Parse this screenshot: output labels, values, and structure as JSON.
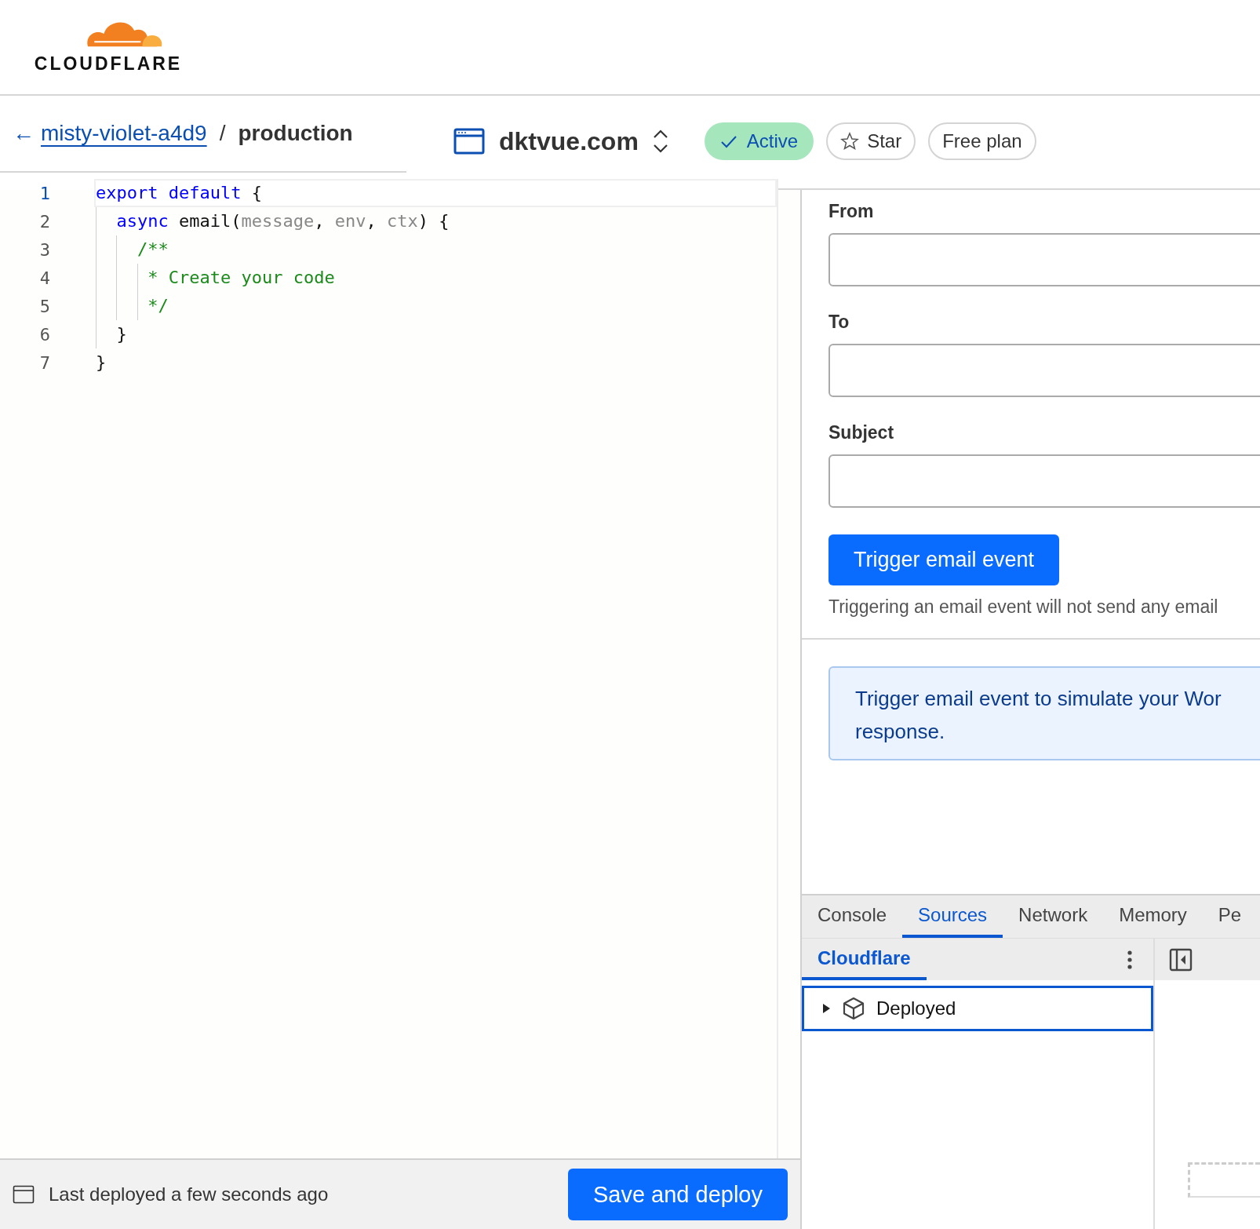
{
  "header": {
    "logo_text": "CLOUDFLARE"
  },
  "breadcrumb": {
    "back_icon": "←",
    "link": "misty-violet-a4d9",
    "separator": "/",
    "current": "production"
  },
  "domain": {
    "title": "dktvue.com",
    "status": {
      "label": "Active",
      "active": true
    },
    "star": {
      "label": "Star",
      "starred": false
    },
    "plan": "Free plan"
  },
  "editor": {
    "lines": [
      {
        "number": "1",
        "selected": true,
        "tokens": [
          {
            "kind": "keyword",
            "text": "export default"
          },
          {
            "kind": "plain",
            "text": " {"
          }
        ]
      },
      {
        "number": "2",
        "selected": false,
        "tokens": [
          {
            "kind": "keyword",
            "text": "  async"
          },
          {
            "kind": "plain",
            "text": " email("
          },
          {
            "kind": "param",
            "text": "message"
          },
          {
            "kind": "plain",
            "text": ", "
          },
          {
            "kind": "param",
            "text": "env"
          },
          {
            "kind": "plain",
            "text": ", "
          },
          {
            "kind": "param",
            "text": "ctx"
          },
          {
            "kind": "plain",
            "text": ") {"
          }
        ]
      },
      {
        "number": "3",
        "selected": false,
        "tokens": [
          {
            "kind": "comment",
            "text": "    /**"
          }
        ]
      },
      {
        "number": "4",
        "selected": false,
        "tokens": [
          {
            "kind": "comment",
            "text": "     * Create your code"
          }
        ]
      },
      {
        "number": "5",
        "selected": false,
        "tokens": [
          {
            "kind": "comment",
            "text": "     */"
          }
        ]
      },
      {
        "number": "6",
        "selected": false,
        "tokens": [
          {
            "kind": "plain",
            "text": "  }"
          }
        ]
      },
      {
        "number": "7",
        "selected": false,
        "tokens": [
          {
            "kind": "plain",
            "text": "}"
          }
        ]
      }
    ]
  },
  "footer": {
    "status": "Last deployed a few seconds ago",
    "button": "Save and deploy"
  },
  "form": {
    "fields": [
      {
        "label": "From"
      },
      {
        "label": "To"
      },
      {
        "label": "Subject"
      }
    ],
    "button": "Trigger email event",
    "note": "Triggering an email event will not send any email"
  },
  "info": {
    "lines": [
      "Trigger email event to simulate your Wor",
      "response."
    ]
  },
  "devtools": {
    "tabs": [
      {
        "label": "Console",
        "selected": false
      },
      {
        "label": "Sources",
        "selected": true
      },
      {
        "label": "Network",
        "selected": false
      },
      {
        "label": "Memory",
        "selected": false
      },
      {
        "label": "Pe",
        "selected": false
      }
    ],
    "subtabs": [
      {
        "label": "Cloudflare",
        "selected": true
      }
    ],
    "tree": [
      {
        "label": "Deployed",
        "expanded": false,
        "selected": true
      }
    ]
  }
}
